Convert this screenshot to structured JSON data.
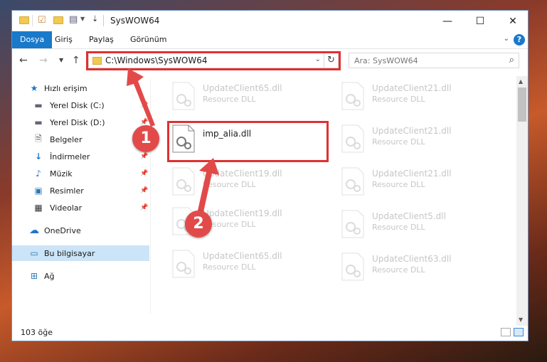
{
  "window": {
    "title": "SysWOW64",
    "controls": {
      "minimize": "—",
      "maximize": "☐",
      "close": "✕"
    }
  },
  "ribbon": {
    "tabs": [
      "Dosya",
      "Giriş",
      "Paylaş",
      "Görünüm"
    ],
    "help": "?"
  },
  "navigation": {
    "address": "C:\\Windows\\SysWOW64",
    "search_placeholder": "Ara: SysWOW64"
  },
  "sidebar": {
    "items": [
      {
        "label": "Hızlı erişim",
        "icon": "star-icon",
        "pinned": false
      },
      {
        "label": "Yerel Disk (C:)",
        "icon": "drive-icon",
        "pinned": true
      },
      {
        "label": "Yerel Disk (D:)",
        "icon": "drive-icon",
        "pinned": true
      },
      {
        "label": "Belgeler",
        "icon": "document-icon",
        "pinned": true
      },
      {
        "label": "İndirmeler",
        "icon": "download-icon",
        "pinned": true
      },
      {
        "label": "Müzik",
        "icon": "music-icon",
        "pinned": true
      },
      {
        "label": "Resimler",
        "icon": "picture-icon",
        "pinned": true
      },
      {
        "label": "Videolar",
        "icon": "video-icon",
        "pinned": true
      },
      {
        "label": "OneDrive",
        "icon": "cloud-icon",
        "pinned": false
      },
      {
        "label": "Bu bilgisayar",
        "icon": "computer-icon",
        "pinned": false,
        "selected": true
      },
      {
        "label": "Ağ",
        "icon": "network-icon",
        "pinned": false
      }
    ]
  },
  "files": {
    "highlighted": {
      "name": "imp_alia.dll"
    },
    "left_column": [
      {
        "name": "UpdateClient65.dll",
        "type": "Resource DLL"
      },
      {
        "name": "UpdateClient19.dll",
        "type": "Resource DLL"
      },
      {
        "name": "UpdateClient19.dll",
        "type": "Resource DLL"
      },
      {
        "name": "UpdateClient65.dll",
        "type": "Resource DLL"
      }
    ],
    "right_column": [
      {
        "name": "UpdateClient21.dll",
        "type": "Resource DLL"
      },
      {
        "name": "UpdateClient21.dll",
        "type": "Resource DLL"
      },
      {
        "name": "UpdateClient21.dll",
        "type": "Resource DLL"
      },
      {
        "name": "UpdateClient5.dll",
        "type": "Resource DLL"
      },
      {
        "name": "UpdateClient63.dll",
        "type": "Resource DLL"
      }
    ]
  },
  "status": {
    "count": "103 öğe"
  },
  "annotations": {
    "step1": "1",
    "step2": "2",
    "color": "#e24a4a"
  }
}
